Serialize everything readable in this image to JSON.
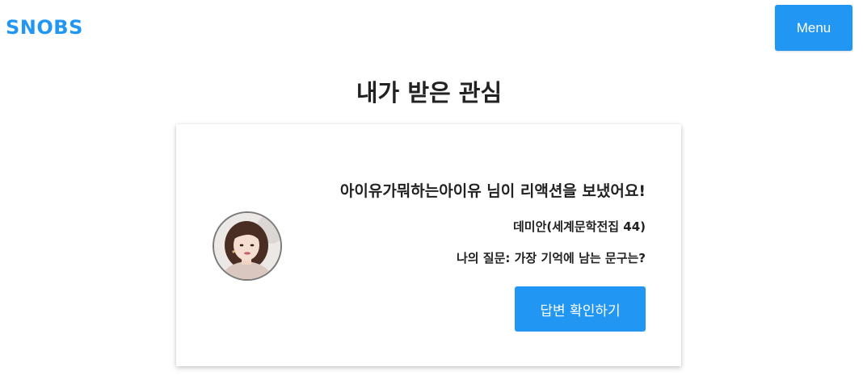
{
  "header": {
    "logo": "SNOBS",
    "menu_label": "Menu"
  },
  "page": {
    "title": "내가 받은 관심"
  },
  "card": {
    "notification": "아이유가뭐하는아이유 님이 리액션을 보냈어요!",
    "book": "데미안(세계문학전집 44)",
    "question": "나의 질문: 가장 기억에 남는 문구는?",
    "answer_button": "답변 확인하기",
    "avatar_icon": "user-avatar-photo"
  },
  "colors": {
    "accent": "#2196f3",
    "text": "#222222",
    "background": "#ffffff"
  }
}
